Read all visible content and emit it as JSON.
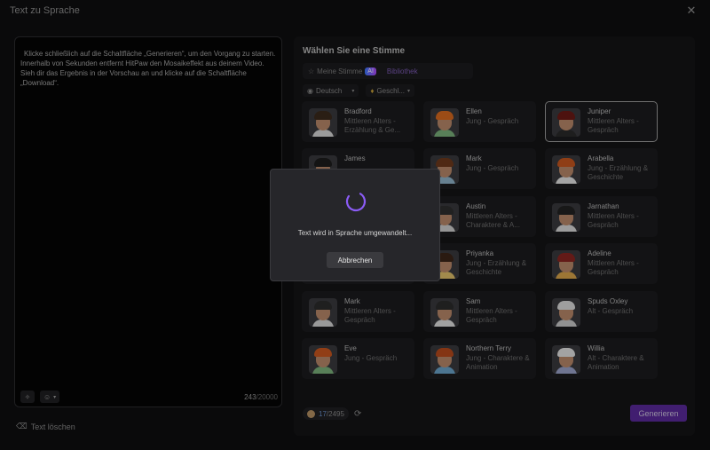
{
  "window": {
    "title": "Text zu Sprache"
  },
  "editor": {
    "text": "Klicke schließlich auf die Schaltfläche „Generieren“, um den Vorgang zu starten. Innerhalb von Sekunden entfernt HitPaw den Mosaikeffekt aus deinem Video. Sieh dir das Ergebnis in der Vorschau an und klicke auf die Schaltfläche „Download“.",
    "count_current": "243",
    "count_max": "/20000",
    "clear_label": "Text löschen"
  },
  "voices": {
    "title": "Wählen Sie eine Stimme",
    "tabs": {
      "mine": "Meine Stimme",
      "ai": "AI",
      "library": "Bibliothek"
    },
    "filters": {
      "language": "Deutsch",
      "gender": "Geschl..."
    },
    "cards": [
      {
        "name": "Bradford",
        "desc": "Mittleren Alters - Erzählung & Ge...",
        "selected": false,
        "hair": "#3b2a1d",
        "shirt": "#d7d7d7"
      },
      {
        "name": "Ellen",
        "desc": "Jung - Gespräch",
        "selected": false,
        "hair": "#d96a1f",
        "shirt": "#7bb07a"
      },
      {
        "name": "Juniper",
        "desc": "Mittleren Alters - Gespräch",
        "selected": true,
        "hair": "#6b1a16",
        "shirt": "#2a2a2a"
      },
      {
        "name": "James",
        "desc": "",
        "selected": false,
        "hair": "#1c1c1c",
        "shirt": "#cfcfcf"
      },
      {
        "name": "Mark",
        "desc": "Jung - Gespräch",
        "selected": false,
        "hair": "#6e3a1c",
        "shirt": "#8fb3c9"
      },
      {
        "name": "Arabella",
        "desc": "Jung - Erzählung & Geschichte",
        "selected": false,
        "hair": "#c7561f",
        "shirt": "#e3e3e3"
      },
      {
        "name": "",
        "desc": "",
        "selected": false,
        "hair": "#333",
        "shirt": "#444"
      },
      {
        "name": "Austin",
        "desc": "Mittleren Alters - Charaktere & A...",
        "selected": false,
        "hair": "#2e2e2e",
        "shirt": "#cfcfcf"
      },
      {
        "name": "Jarnathan",
        "desc": "Mittleren Alters - Gespräch",
        "selected": false,
        "hair": "#222",
        "shirt": "#d9d9d9"
      },
      {
        "name": "",
        "desc": "",
        "selected": false,
        "hair": "#333",
        "shirt": "#444"
      },
      {
        "name": "Priyanka",
        "desc": "Jung - Erzählung & Geschichte",
        "selected": false,
        "hair": "#3b2418",
        "shirt": "#e0c06a"
      },
      {
        "name": "Adeline",
        "desc": "Mittleren Alters - Gespräch",
        "selected": false,
        "hair": "#8a2420",
        "shirt": "#d9a44a"
      },
      {
        "name": "Mark",
        "desc": "Mittleren Alters - Gespräch",
        "selected": false,
        "hair": "#2b2b2b",
        "shirt": "#d4d4d4"
      },
      {
        "name": "Sam",
        "desc": "Mittleren Alters - Gespräch",
        "selected": false,
        "hair": "#2b2b2b",
        "shirt": "#e0e0e0"
      },
      {
        "name": "Spuds Oxley",
        "desc": "Alt - Gespräch",
        "selected": false,
        "hair": "#dcdcdc",
        "shirt": "#c9c9c9"
      },
      {
        "name": "Eve",
        "desc": "Jung - Gespräch",
        "selected": false,
        "hair": "#c9561f",
        "shirt": "#7bb07a"
      },
      {
        "name": "Northern Terry",
        "desc": "Jung - Charaktere & Animation",
        "selected": false,
        "hair": "#b84a1c",
        "shirt": "#6aa3c9"
      },
      {
        "name": "Willia",
        "desc": "Alt - Charaktere & Animation",
        "selected": false,
        "hair": "#e2e2e2",
        "shirt": "#9aa3c9"
      }
    ]
  },
  "footer": {
    "credits_used": "17",
    "credits_total": "/2495",
    "generate_label": "Generieren"
  },
  "dialog": {
    "message": "Text wird in Sprache umgewandelt...",
    "cancel_label": "Abbrechen"
  },
  "colors": {
    "accent": "#5b2a9c",
    "spinner": "#8b5cf6"
  }
}
